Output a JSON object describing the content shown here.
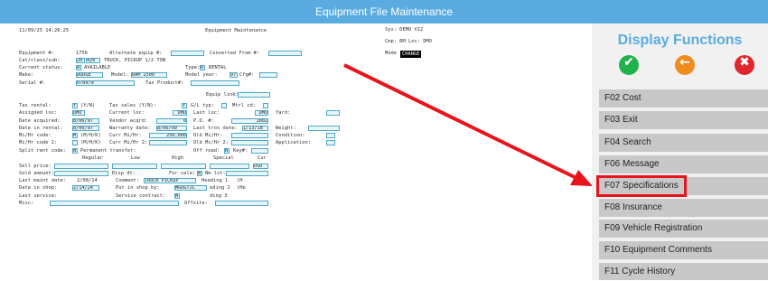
{
  "window": {
    "title": "Equipment File Maintenance"
  },
  "header": {
    "date_time": "11/09/25 14:26:25",
    "screen_name": "Equipment Maintenance",
    "sys": "Sys: DEMO V12",
    "cmp": "Cmp: RM Loc: DMO",
    "mode_label": "Mode",
    "mode_value": "CHANGE"
  },
  "labels": {
    "equipment": "Equipment #:",
    "cat_class_sub": "Cat/class/sub:",
    "current_status": "Current status:",
    "make": "Make:",
    "serial": "Serial #:",
    "alt_equip": "Alternate equip #:",
    "converted_from": "Converted From #:",
    "type": "Type:",
    "model": "Model:",
    "model_year": "Model year:",
    "cfg": "Cfg#:",
    "tax_product": "Tax Product#:",
    "equip_link": "Equip link:",
    "tax_rental": "Tax rental:",
    "yn1": "(Y/N)",
    "tax_sales": "Tax sales (Y/N):",
    "gl_typ": "G/L typ:",
    "mtrl_cd": "Mtrl cd:",
    "assigned_loc": "Assigned loc:",
    "current_loc": "Current loc:",
    "last_loc": "Last loc:",
    "yard": "Yard:",
    "date_acquired": "Date acquired:",
    "vendor_acqrd": "Vendor acqrd:",
    "po": "P.O. #:",
    "date_in_rental": "Date in rental:",
    "warranty_date": "Warranty date:",
    "last_tros_date": "Last tros date:",
    "weight": "Weight:",
    "mihr_code": "Mi/Hr code:",
    "mhk1": "(M/H/K)",
    "curr_mihr": "Curr Mi/Hr:",
    "old_mihr": "Old Mi/Hr:",
    "condition": "Condition:",
    "mihr_code2": "Mi/Hr code 2:",
    "mhk2": "(M/H/K)",
    "curr_mihr2": "Curr Mi/Hr 2:",
    "old_mihr2": "Old Mi/Hr 2:",
    "application": "Application:",
    "split_rent": "Split rent code:",
    "permanent_transfer": "Permanent transfer:",
    "off_road": "Off road:",
    "key": "Key#:",
    "regular": "Regular",
    "low": "Low",
    "high": "High",
    "special": "Special",
    "cur": "Cur",
    "sell_price": "Sell price:",
    "sold_amount": "Sold amount:",
    "disp_dt": "Disp dt:",
    "for_sale": "For sale:",
    "nm_lst": "Nm lst:",
    "last_maint": "Last maint date:",
    "comment": "Comment:",
    "heading1": "Heading 1",
    "date_in_shop": "Date in shop:",
    "put_in_shop_by": "Put in shop by:",
    "heading2": "eding 2",
    "last_service": "Last service:",
    "service_contract": "Service contract:",
    "heading3": "ding 3",
    "misc": "Misc:",
    "offsite": "Offsite:",
    "h1": "(H",
    "h2": "(He"
  },
  "values": {
    "equipment": "1756",
    "cat": "20",
    "class": "420",
    "cat_desc": "TRUCK, PICKUP 1/2 TON",
    "status_code": "A",
    "status_desc": "AVAILABLE",
    "type_code": "R",
    "type_desc": "RENTAL",
    "make": "DODGE",
    "model": "RAM 2500",
    "model_year": "97",
    "serial": "070979",
    "tax_rental": "Y",
    "tax_sales": "Y",
    "assigned_loc": "DMO",
    "current_loc": "DMO",
    "last_loc": "DMO",
    "date_acquired": "8/06/97",
    "vendor_acqrd": "0",
    "po": "1002",
    "date_in_rental": "8/06/97",
    "warranty_date": "8/06/99",
    "last_tros_date": "1/13/18",
    "mihr_code": "M",
    "curr_mihr": "250,000",
    "mihr_code2": "",
    "split_rent": "N",
    "off_road": "N",
    "cur": "USD",
    "for_sale": "N",
    "last_maint": "2/08/14",
    "comment": "TRUCK PICKUP",
    "date_in_shop": "2/14/24",
    "put_in_shop_by": "MGOGTJL",
    "service_contract": "N"
  },
  "display_functions": {
    "title": "Display Functions",
    "icons": [
      {
        "name": "check-icon",
        "glyph": "✔",
        "color": "#22b24c"
      },
      {
        "name": "back-arrow-icon",
        "glyph": "←",
        "color": "#f08c1e"
      },
      {
        "name": "close-icon",
        "glyph": "✖",
        "color": "#e3262d"
      }
    ],
    "keys": [
      "F02 Cost",
      "F03 Exit",
      "F04 Search",
      "F06 Message",
      "F07 Specifications",
      "F08 Insurance",
      "F09 Vehicle Registration",
      "F10 Equipment Comments",
      "F11 Cycle History"
    ],
    "highlighted": "F07 Specifications"
  },
  "colors": {
    "accent": "#5aace0",
    "annotation": "#e8141c"
  }
}
